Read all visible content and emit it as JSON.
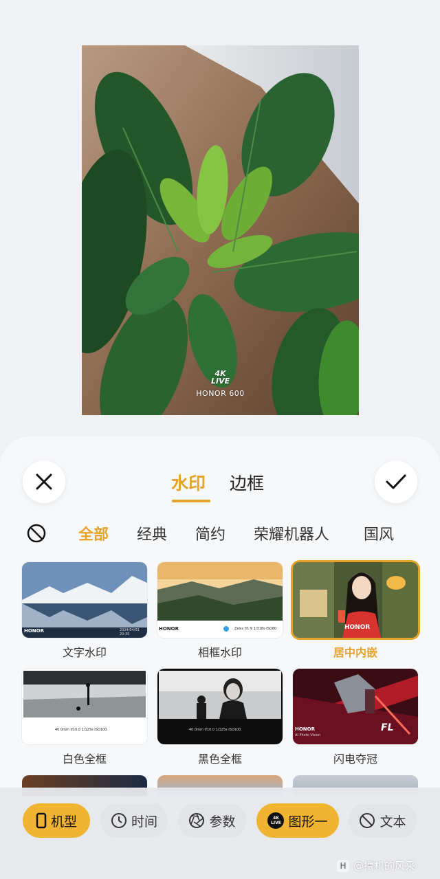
{
  "preview": {
    "badge_top": "4K",
    "badge_bottom": "LIVE",
    "brand": "HONOR 600"
  },
  "tabs": [
    {
      "label": "水印",
      "active": true
    },
    {
      "label": "边框",
      "active": false
    }
  ],
  "categories": [
    {
      "label": "全部",
      "active": true
    },
    {
      "label": "经典",
      "active": false
    },
    {
      "label": "简约",
      "active": false
    },
    {
      "label": "荣耀机器人",
      "active": false
    },
    {
      "label": "国风",
      "active": false
    }
  ],
  "templates": [
    {
      "label": "文字水印",
      "selected": false,
      "strip_brand": "HONOR",
      "strip_meta": "2024/04/01 20:30"
    },
    {
      "label": "相框水印",
      "selected": false,
      "strip_brand": "HONOR",
      "strip_meta": "Zeiss f/1.9 1/318s ISO80"
    },
    {
      "label": "居中内嵌",
      "selected": true,
      "strip_brand": "HONOR"
    },
    {
      "label": "白色全框",
      "selected": false,
      "strip_meta": "40.0mm  f/10.0  1/125s  ISO100"
    },
    {
      "label": "黑色全框",
      "selected": false,
      "strip_meta": "40.0mm  f/10.0  1/125s  ISO100"
    },
    {
      "label": "闪电夺冠",
      "selected": false,
      "strip_brand": "HONOR",
      "strip_meta": "AI Photo Vision",
      "art_text": "FL"
    }
  ],
  "toolbar": [
    {
      "label": "机型",
      "icon": "phone-icon",
      "active": true
    },
    {
      "label": "时间",
      "icon": "clock-icon",
      "active": false
    },
    {
      "label": "参数",
      "icon": "aperture-icon",
      "active": false
    },
    {
      "label": "图形一",
      "icon": "4k-live-icon",
      "active": true,
      "icon_text": "4K LIVE"
    },
    {
      "label": "文本",
      "icon": "no-text-icon",
      "active": false
    }
  ],
  "footer": {
    "text": "@搞机的风采",
    "box": "H"
  },
  "colors": {
    "accent": "#e6a228",
    "chip_active": "#f0b432"
  }
}
